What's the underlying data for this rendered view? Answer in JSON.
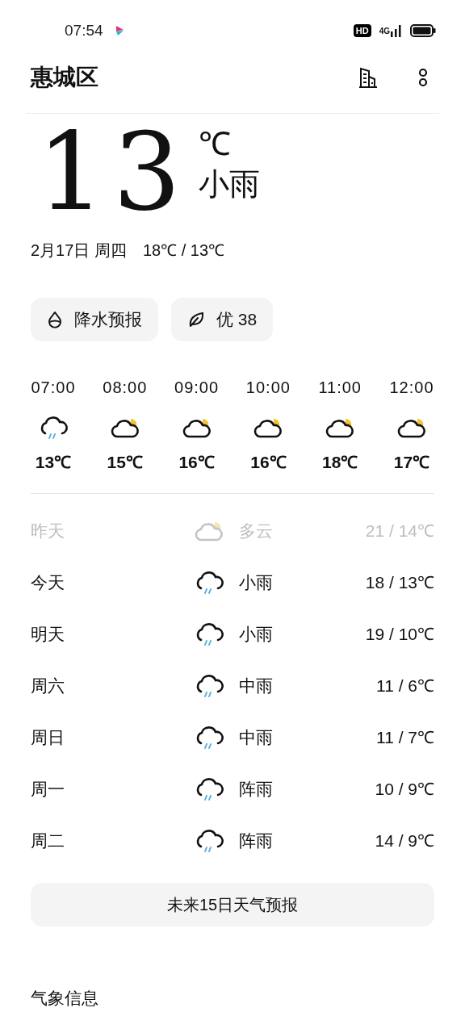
{
  "status_bar": {
    "time": "07:54",
    "hd": "HD",
    "network": "4G"
  },
  "header": {
    "city": "惠城区"
  },
  "current": {
    "temp": "13",
    "unit": "℃",
    "condition": "小雨",
    "date": "2月17日 周四",
    "range": "18℃ / 13℃"
  },
  "chips": [
    {
      "kind": "drop",
      "label": "降水预报"
    },
    {
      "kind": "leaf",
      "label": "优 38"
    }
  ],
  "hourly": [
    {
      "time": "07:00",
      "kind": "rain",
      "temp": "13℃"
    },
    {
      "time": "08:00",
      "kind": "partly_cloudy",
      "temp": "15℃"
    },
    {
      "time": "09:00",
      "kind": "partly_cloudy",
      "temp": "16℃"
    },
    {
      "time": "10:00",
      "kind": "partly_cloudy",
      "temp": "16℃"
    },
    {
      "time": "11:00",
      "kind": "partly_cloudy",
      "temp": "18℃"
    },
    {
      "time": "12:00",
      "kind": "partly_cloudy",
      "temp": "17℃"
    }
  ],
  "daily": [
    {
      "day": "昨天",
      "kind": "partly_cloudy",
      "condition": "多云",
      "range": "21 / 14℃",
      "past": true
    },
    {
      "day": "今天",
      "kind": "rain",
      "condition": "小雨",
      "range": "18 / 13℃",
      "past": false
    },
    {
      "day": "明天",
      "kind": "rain",
      "condition": "小雨",
      "range": "19 / 10℃",
      "past": false
    },
    {
      "day": "周六",
      "kind": "rain",
      "condition": "中雨",
      "range": "11 / 6℃",
      "past": false
    },
    {
      "day": "周日",
      "kind": "rain",
      "condition": "中雨",
      "range": "11 / 7℃",
      "past": false
    },
    {
      "day": "周一",
      "kind": "rain",
      "condition": "阵雨",
      "range": "10 / 9℃",
      "past": false
    },
    {
      "day": "周二",
      "kind": "rain",
      "condition": "阵雨",
      "range": "14 / 9℃",
      "past": false
    }
  ],
  "forecast_button": "未来15日天气预报",
  "section_title": "气象信息"
}
